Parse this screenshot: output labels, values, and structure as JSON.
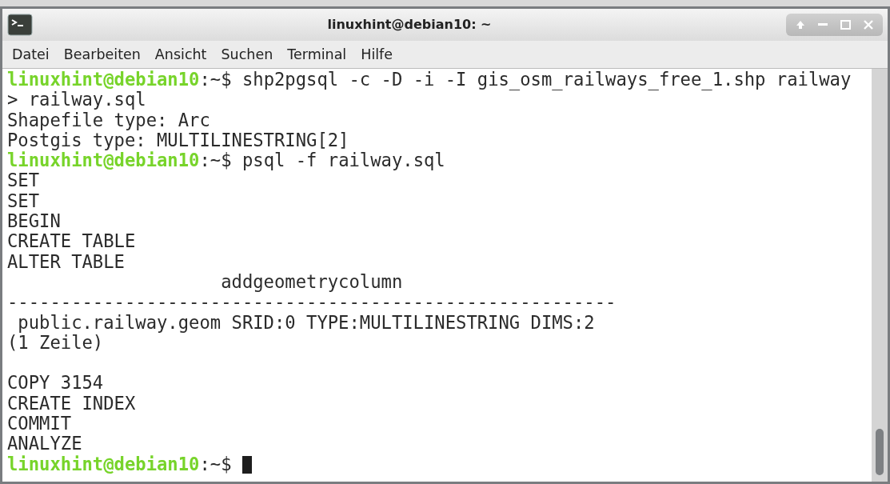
{
  "window": {
    "title": "linuxhint@debian10: ~"
  },
  "menu": [
    "Datei",
    "Bearbeiten",
    "Ansicht",
    "Suchen",
    "Terminal",
    "Hilfe"
  ],
  "terminal": {
    "cursor_visible": true,
    "lines": [
      {
        "kind": "prompt",
        "user_host": "linuxhint@debian10",
        "path": ":~$",
        "command": "shp2pgsql -c -D -i -I gis_osm_railways_free_1.shp railway"
      },
      {
        "kind": "output",
        "text": "> railway.sql"
      },
      {
        "kind": "output",
        "text": "Shapefile type: Arc"
      },
      {
        "kind": "output",
        "text": "Postgis type: MULTILINESTRING[2]"
      },
      {
        "kind": "prompt",
        "user_host": "linuxhint@debian10",
        "path": ":~$",
        "command": "psql -f railway.sql"
      },
      {
        "kind": "output",
        "text": "SET"
      },
      {
        "kind": "output",
        "text": "SET"
      },
      {
        "kind": "output",
        "text": "BEGIN"
      },
      {
        "kind": "output",
        "text": "CREATE TABLE"
      },
      {
        "kind": "output",
        "text": "ALTER TABLE"
      },
      {
        "kind": "output",
        "text": "                    addgeometrycolumn"
      },
      {
        "kind": "output",
        "text": "---------------------------------------------------------"
      },
      {
        "kind": "output",
        "text": " public.railway.geom SRID:0 TYPE:MULTILINESTRING DIMS:2"
      },
      {
        "kind": "output",
        "text": "(1 Zeile)"
      },
      {
        "kind": "blank"
      },
      {
        "kind": "output",
        "text": "COPY 3154"
      },
      {
        "kind": "output",
        "text": "CREATE INDEX"
      },
      {
        "kind": "output",
        "text": "COMMIT"
      },
      {
        "kind": "output",
        "text": "ANALYZE"
      },
      {
        "kind": "prompt",
        "user_host": "linuxhint@debian10",
        "path": ":~$"
      }
    ]
  }
}
